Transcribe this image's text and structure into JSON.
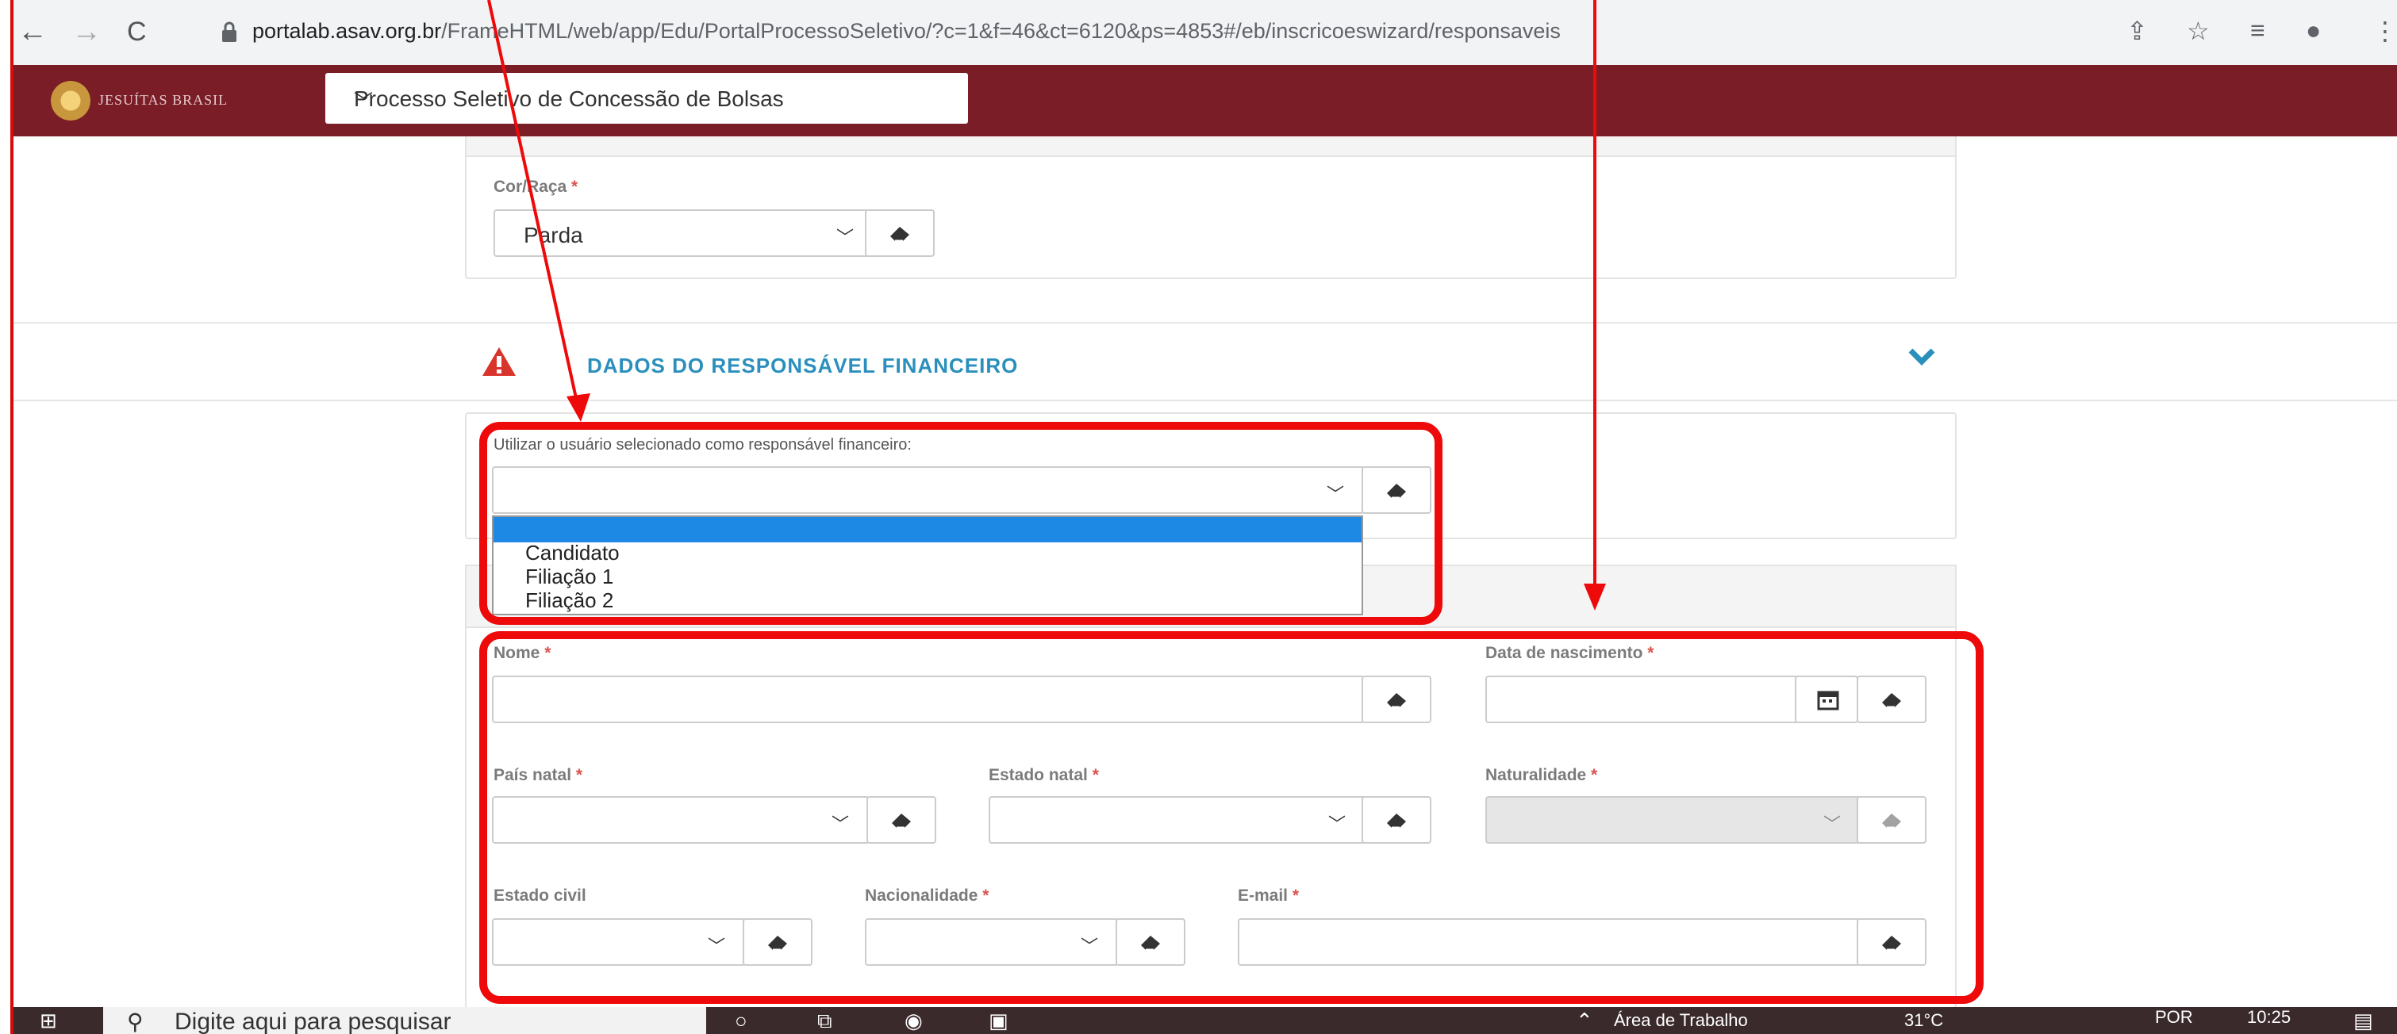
{
  "browser": {
    "url_host": "portalab.asav.org.br",
    "url_path": "/FrameHTML/web/app/Edu/PortalProcessoSeletivo/?c=1&f=46&ct=6120&ps=4853#/eb/inscricoeswizard/responsaveis",
    "icons": [
      "back-icon",
      "forward-icon",
      "reload-icon",
      "lock-icon",
      "share-icon",
      "star-icon",
      "reading-list-icon",
      "profile-icon",
      "menu-icon"
    ]
  },
  "appbar": {
    "brand": "JESUÍTAS BRASIL",
    "process_select": "Processo Seletivo de Concessão de Bolsas"
  },
  "race_panel": {
    "label": "Cor/Raça",
    "value": "Parda"
  },
  "section": {
    "title": "DADOS DO RESPONSÁVEL FINANCEIRO"
  },
  "responsible_panel": {
    "label": "Utilizar o usuário selecionado como responsável financeiro:",
    "options": [
      "Candidato",
      "Filiação 1",
      "Filiação 2"
    ]
  },
  "form": {
    "nome": "Nome",
    "data_nascimento": "Data de nascimento",
    "pais_natal": "País natal",
    "estado_natal": "Estado natal",
    "naturalidade": "Naturalidade",
    "estado_civil": "Estado civil",
    "nacionalidade": "Nacionalidade",
    "email": "E-mail",
    "required_mark": "*"
  },
  "taskbar": {
    "search_placeholder": "Digite aqui para pesquisar",
    "desktop": "Área de Trabalho",
    "temp": "31°C",
    "lang": "POR",
    "time": "10:25"
  },
  "colors": {
    "appbar": "#7b1d27",
    "section_title": "#2a8fbd",
    "annotation": "#ee0a0a",
    "required": "#d9534f",
    "highlight": "#1e88e5"
  }
}
